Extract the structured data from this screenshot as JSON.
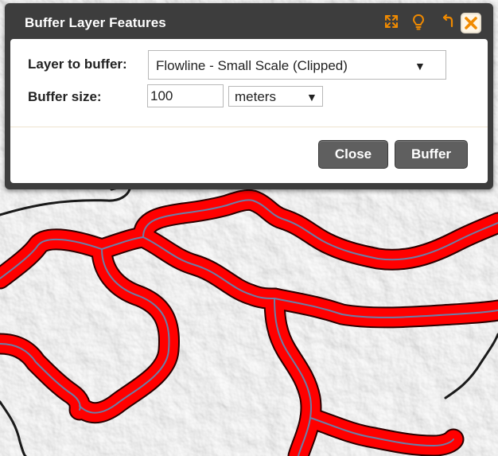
{
  "dialog": {
    "title": "Buffer Layer Features",
    "icons": [
      "expand-icon",
      "lightbulb-icon",
      "undo-icon",
      "close-icon"
    ],
    "layer_label": "Layer to buffer:",
    "layer_value": "Flowline - Small Scale (Clipped)",
    "size_label": "Buffer size:",
    "size_value": "100",
    "unit_value": "meters",
    "dropdown_arrow": "▼",
    "close_label": "Close",
    "buffer_label": "Buffer"
  },
  "colors": {
    "accent": "#f08a00",
    "dialog_bg": "#3d3d3d",
    "button_bg": "#5f5f5f",
    "buffer_fill": "#ff0000",
    "flowline": "#6b7fa8",
    "boundary": "#1a1a1a",
    "map_bg": "#e6e6e6"
  }
}
